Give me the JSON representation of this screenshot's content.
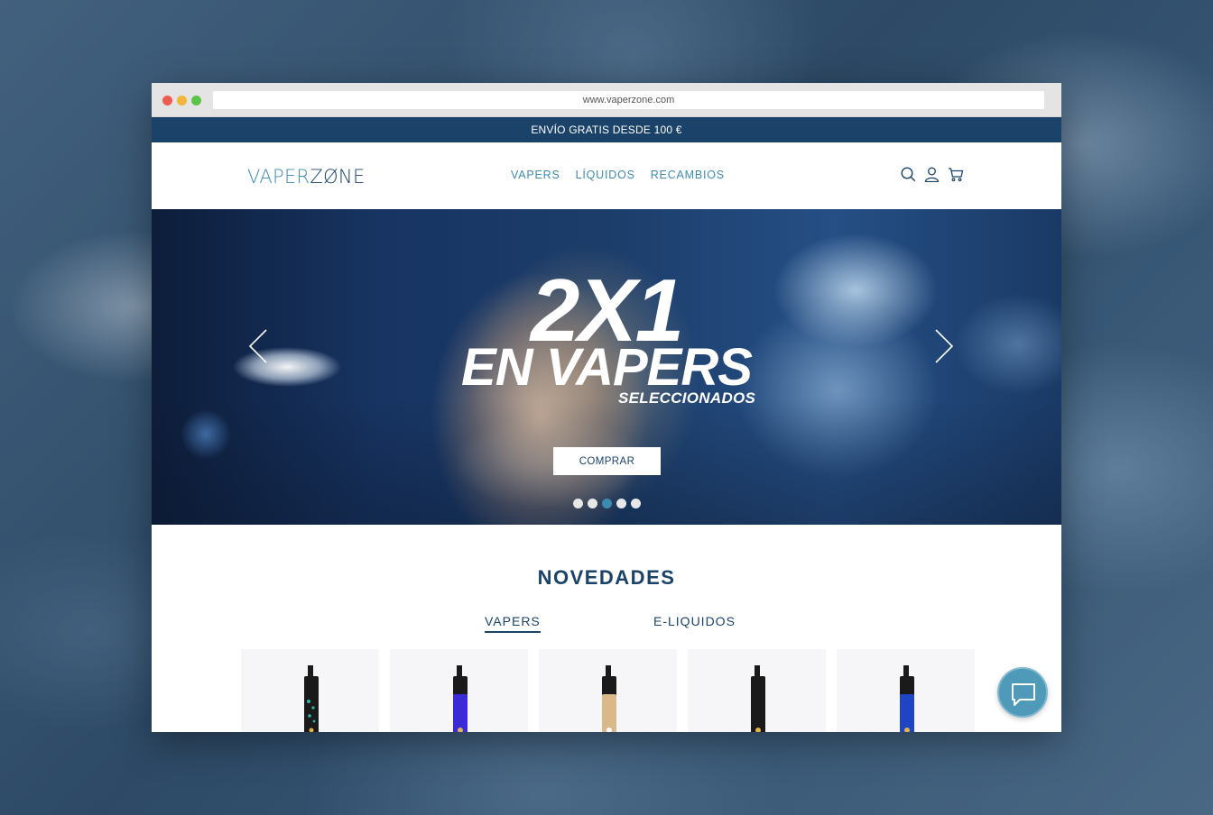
{
  "browser": {
    "url": "www.vaperzone.com"
  },
  "promo_bar": {
    "text": "ENVÍO GRATIS DESDE 100 €"
  },
  "header": {
    "logo_part1": "VAPER",
    "logo_part2": "ZØNE",
    "nav": [
      {
        "label": "VAPERS"
      },
      {
        "label": "LÍQUIDOS"
      },
      {
        "label": "RECAMBIOS"
      }
    ],
    "icons": [
      "search-icon",
      "user-icon",
      "cart-icon"
    ]
  },
  "hero": {
    "headline": "2X1",
    "subheadline": "EN VAPERS",
    "small": "SELECCIONADOS",
    "cta": "COMPRAR",
    "slides_total": 5,
    "active_slide": 3
  },
  "novedades": {
    "title": "NOVEDADES",
    "tabs": [
      {
        "label": "VAPERS",
        "active": true
      },
      {
        "label": "E-LIQUIDOS",
        "active": false
      }
    ],
    "products": [
      {
        "accent": "#1a1a1a",
        "pattern": "#2fb6b0"
      },
      {
        "accent": "#3a2bd6",
        "pattern": "#5a48f0"
      },
      {
        "accent": "#d9b88a",
        "pattern": "#e8cda6"
      },
      {
        "accent": "#1a1a1a",
        "pattern": "#2a2a2a"
      },
      {
        "accent": "#1f44c4",
        "pattern": "#3060e0"
      }
    ]
  },
  "colors": {
    "brand_dark": "#1b4369",
    "brand_light": "#3d8ab0",
    "chat_bubble": "#4e9ab8"
  }
}
